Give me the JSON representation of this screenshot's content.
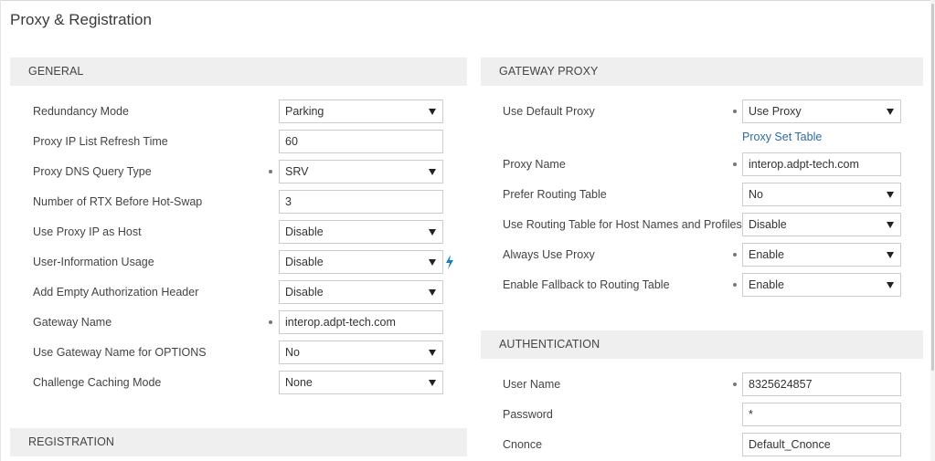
{
  "page_title": "Proxy & Registration",
  "general": {
    "title": "GENERAL",
    "rows": [
      {
        "label": "Redundancy Mode",
        "type": "select",
        "value": "Parking"
      },
      {
        "label": "Proxy IP List Refresh Time",
        "type": "input",
        "value": "60"
      },
      {
        "label": "Proxy DNS Query Type",
        "type": "select",
        "value": "SRV",
        "modified": true
      },
      {
        "label": "Number of RTX Before Hot-Swap",
        "type": "input",
        "value": "3"
      },
      {
        "label": "Use Proxy IP as Host",
        "type": "select",
        "value": "Disable"
      },
      {
        "label": "User-Information Usage",
        "type": "select",
        "value": "Disable",
        "icon": "lightning-bolt-icon"
      },
      {
        "label": "Add Empty Authorization Header",
        "type": "select",
        "value": "Disable"
      },
      {
        "label": "Gateway Name",
        "type": "input",
        "value": "interop.adpt-tech.com",
        "modified": true
      },
      {
        "label": "Use Gateway Name for OPTIONS",
        "type": "select",
        "value": "No"
      },
      {
        "label": "Challenge Caching Mode",
        "type": "select",
        "value": "None"
      }
    ]
  },
  "registration": {
    "title": "REGISTRATION"
  },
  "gateway_proxy": {
    "title": "GATEWAY PROXY",
    "rows": [
      {
        "label": "Use Default Proxy",
        "type": "select",
        "value": "Use Proxy",
        "modified": true
      },
      {
        "label": "Proxy Name",
        "type": "input",
        "value": "interop.adpt-tech.com",
        "modified": true
      },
      {
        "label": "Prefer Routing Table",
        "type": "select",
        "value": "No"
      },
      {
        "label": "Use Routing Table for Host Names and Profiles",
        "type": "select",
        "value": "Disable"
      },
      {
        "label": "Always Use Proxy",
        "type": "select",
        "value": "Enable",
        "modified": true
      },
      {
        "label": "Enable Fallback to Routing Table",
        "type": "select",
        "value": "Enable",
        "modified": true
      }
    ],
    "link": "Proxy Set Table"
  },
  "authentication": {
    "title": "AUTHENTICATION",
    "rows": [
      {
        "label": "User Name",
        "type": "input",
        "value": "8325624857",
        "modified": true
      },
      {
        "label": "Password",
        "type": "input",
        "value": "*"
      },
      {
        "label": "Cnonce",
        "type": "input",
        "value": "Default_Cnonce"
      }
    ]
  },
  "colors": {
    "link": "#2e6aa3",
    "bolt": "#1a7fc1",
    "header_bg": "#efefef"
  }
}
